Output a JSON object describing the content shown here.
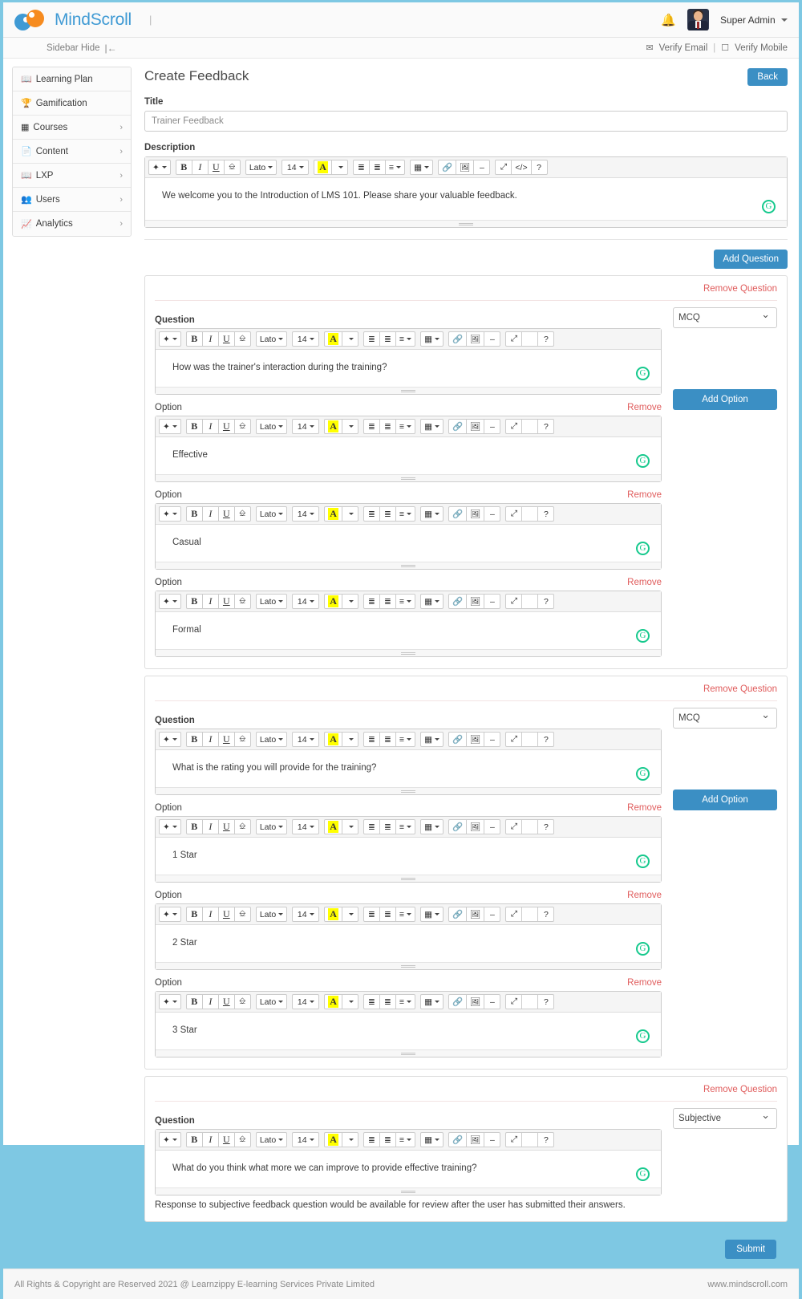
{
  "brand": {
    "name": "MindScroll",
    "divider": "|",
    "accent_blue": "#3b8fc4",
    "accent_orange": "#f68b1f",
    "logo_blue": "#3f9ad4"
  },
  "topbar": {
    "bell_icon": "bell-icon",
    "user_name": "Super Admin",
    "avatar_alt": "user-avatar"
  },
  "subbar": {
    "sidebar_hide": "Sidebar Hide",
    "sidebar_hide_arrow": "|←",
    "verify_email": "Verify Email",
    "separator": "|",
    "verify_mobile": "Verify Mobile",
    "email_icon": "envelope-icon",
    "mobile_icon": "mobile-icon"
  },
  "sidebar": {
    "items": [
      {
        "label": "Learning Plan",
        "icon": "book-icon",
        "chevron": ""
      },
      {
        "label": "Gamification",
        "icon": "trophy-icon",
        "chevron": ""
      },
      {
        "label": "Courses",
        "icon": "window-icon",
        "chevron": "›"
      },
      {
        "label": "Content",
        "icon": "file-icon",
        "chevron": "›"
      },
      {
        "label": "LXP",
        "icon": "book-icon",
        "chevron": "›"
      },
      {
        "label": "Users",
        "icon": "users-icon",
        "chevron": "›"
      },
      {
        "label": "Analytics",
        "icon": "chart-icon",
        "chevron": "›"
      }
    ]
  },
  "page": {
    "title": "Create Feedback",
    "back_label": "Back",
    "add_question_label": "Add Question",
    "submit_label": "Submit"
  },
  "form": {
    "title_label": "Title",
    "title_value": "Trainer Feedback",
    "description_label": "Description",
    "description_value": "We welcome you to the Introduction of LMS 101. Please share your valuable feedback."
  },
  "editor_toolbar": {
    "style_icon": "magic-wand-icon",
    "bold": "B",
    "italic": "I",
    "underline": "U",
    "remove_format_icon": "eraser-icon",
    "font_family": "Lato",
    "font_size": "14",
    "text_color": "A",
    "unordered_list_icon": "unordered-list-icon",
    "ordered_list_icon": "ordered-list-icon",
    "align_icon": "align-icon",
    "table_icon": "table-icon",
    "link_icon": "link-icon",
    "image_icon": "image-icon",
    "hr_icon": "horizontal-rule-icon",
    "fullscreen_icon": "fullscreen-icon",
    "code_icon": "code-view-icon",
    "help_icon": "help-icon",
    "code_label": "</>",
    "help_label": "?",
    "hr_label": "–",
    "fullscreen_label": "⤢"
  },
  "labels": {
    "question": "Question",
    "option": "Option",
    "remove_question": "Remove Question",
    "remove_option": "Remove",
    "add_option": "Add Option",
    "grammarly_icon": "grammarly-icon",
    "grammarly_glyph": "G"
  },
  "questions": [
    {
      "type": "MCQ",
      "text": "How was the trainer's interaction during the training?",
      "options": [
        {
          "text": "Effective"
        },
        {
          "text": "Casual"
        },
        {
          "text": "Formal"
        }
      ],
      "note": ""
    },
    {
      "type": "MCQ",
      "text": "What is the rating you will provide for the training?",
      "options": [
        {
          "text": "1 Star"
        },
        {
          "text": "2 Star"
        },
        {
          "text": "3 Star"
        }
      ],
      "note": ""
    },
    {
      "type": "Subjective",
      "text": "What do you think what more we can improve to provide effective training?",
      "options": [],
      "note": "Response to subjective feedback question would be available for review after the user has submitted their answers."
    }
  ],
  "question_types": [
    "MCQ",
    "Subjective"
  ],
  "footer": {
    "copyright": "All Rights & Copyright are Reserved 2021 @ Learnzippy E-learning Services Private Limited",
    "website": "www.mindscroll.com"
  }
}
